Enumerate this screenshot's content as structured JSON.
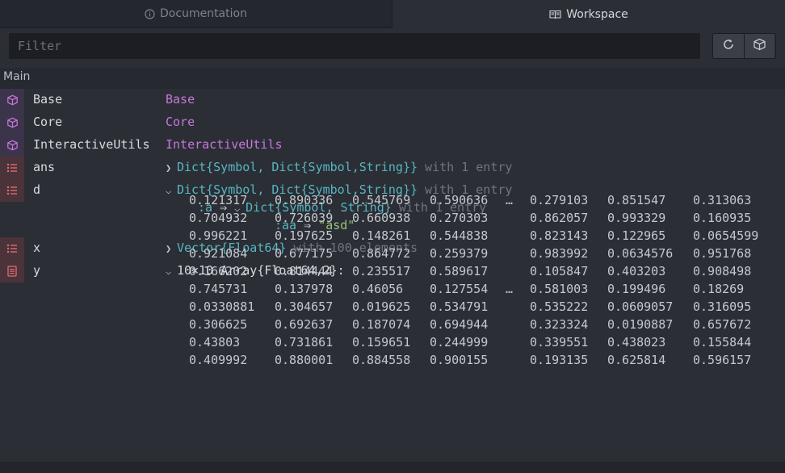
{
  "tabs": {
    "documentation": "Documentation",
    "workspace": "Workspace"
  },
  "filter": {
    "placeholder": "Filter",
    "value": ""
  },
  "module": "Main",
  "vars": [
    {
      "name": "Base",
      "value": "Base",
      "kind": "module"
    },
    {
      "name": "Core",
      "value": "Core",
      "kind": "module"
    },
    {
      "name": "InteractiveUtils",
      "value": "InteractiveUtils",
      "kind": "module"
    },
    {
      "name": "ans",
      "type": "Dict{Symbol, Dict{Symbol,String}}",
      "suffix": "with 1 entry",
      "kind": "variable"
    },
    {
      "name": "d",
      "type": "Dict{Symbol, Dict{Symbol,String}}",
      "suffix": "with 1 entry",
      "kind": "variable",
      "entry_key": ":a",
      "arrow": "⇒",
      "entry_type": "Dict{Symbol, String}",
      "entry_suffix": "with 1 entry",
      "inner_key": ":aa",
      "inner_value": "\"asd\""
    },
    {
      "name": "x",
      "type": "Vector{Float64}",
      "suffix": "with 100 elements",
      "kind": "variable"
    },
    {
      "name": "y",
      "header": "10×10 Array{Float64,2}:",
      "kind": "variable"
    }
  ],
  "matrix": {
    "ellipsis": "…",
    "rows": [
      [
        "0.121317",
        "0.890336",
        "0.545769",
        "0.590636",
        "0.279103",
        "0.851547",
        "0.313063"
      ],
      [
        "0.704932",
        "0.726039",
        "0.660938",
        "0.270303",
        "0.862057",
        "0.993329",
        "0.160935"
      ],
      [
        "0.996221",
        "0.197625",
        "0.148261",
        "0.544838",
        "0.823143",
        "0.122965",
        "0.0654599"
      ],
      [
        "0.921084",
        "0.677175",
        "0.864772",
        "0.259379",
        "0.983992",
        "0.0634576",
        "0.951768"
      ],
      [
        "0.166202",
        "0.814444",
        "0.235517",
        "0.589617",
        "0.105847",
        "0.403203",
        "0.908498"
      ],
      [
        "0.745731",
        "0.137978",
        "0.46056",
        "0.127554",
        "0.581003",
        "0.199496",
        "0.18269"
      ],
      [
        "0.0330881",
        "0.304657",
        "0.019625",
        "0.534791",
        "0.535222",
        "0.0609057",
        "0.316095"
      ],
      [
        "0.306625",
        "0.692637",
        "0.187074",
        "0.694944",
        "0.323324",
        "0.0190887",
        "0.657672"
      ],
      [
        "0.43803",
        "0.731861",
        "0.159651",
        "0.244999",
        "0.339551",
        "0.438023",
        "0.155844"
      ],
      [
        "0.409992",
        "0.880001",
        "0.884558",
        "0.900155",
        "0.193135",
        "0.625814",
        "0.596157"
      ]
    ]
  },
  "colors": {
    "module_text": "#c678dd",
    "type_text": "#56b6c2",
    "string_text": "#98c379",
    "module_badge": "#3c344a",
    "variable_badge": "#4a3339"
  }
}
